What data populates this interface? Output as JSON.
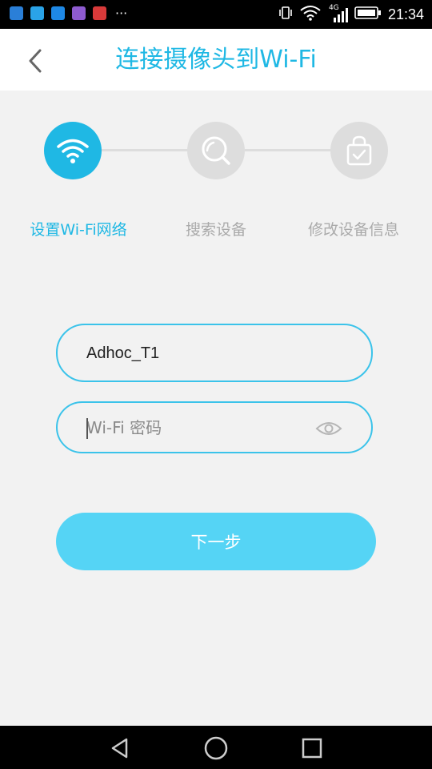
{
  "status_bar": {
    "time": "21:34",
    "network": "4G",
    "notification_icons": [
      "x-app-icon",
      "browser-app-icon",
      "photo-app-icon",
      "gallery-app-icon",
      "huawei-app-icon"
    ],
    "overflow": "···"
  },
  "header": {
    "title": "连接摄像头到Wi-Fi"
  },
  "steps": [
    {
      "label": "设置Wi-Fi网络",
      "icon": "wifi-icon",
      "active": true
    },
    {
      "label": "搜索设备",
      "icon": "search-icon",
      "active": false
    },
    {
      "label": "修改设备信息",
      "icon": "bag-check-icon",
      "active": false
    }
  ],
  "form": {
    "ssid_value": "Adhoc_T1",
    "password_placeholder": "Wi-Fi 密码",
    "password_value": ""
  },
  "next_button": {
    "label": "下一步"
  },
  "colors": {
    "accent": "#1fb8e4",
    "button": "#55d4f5",
    "inactive": "#dddddd",
    "inactive_text": "#aaaaaa"
  }
}
